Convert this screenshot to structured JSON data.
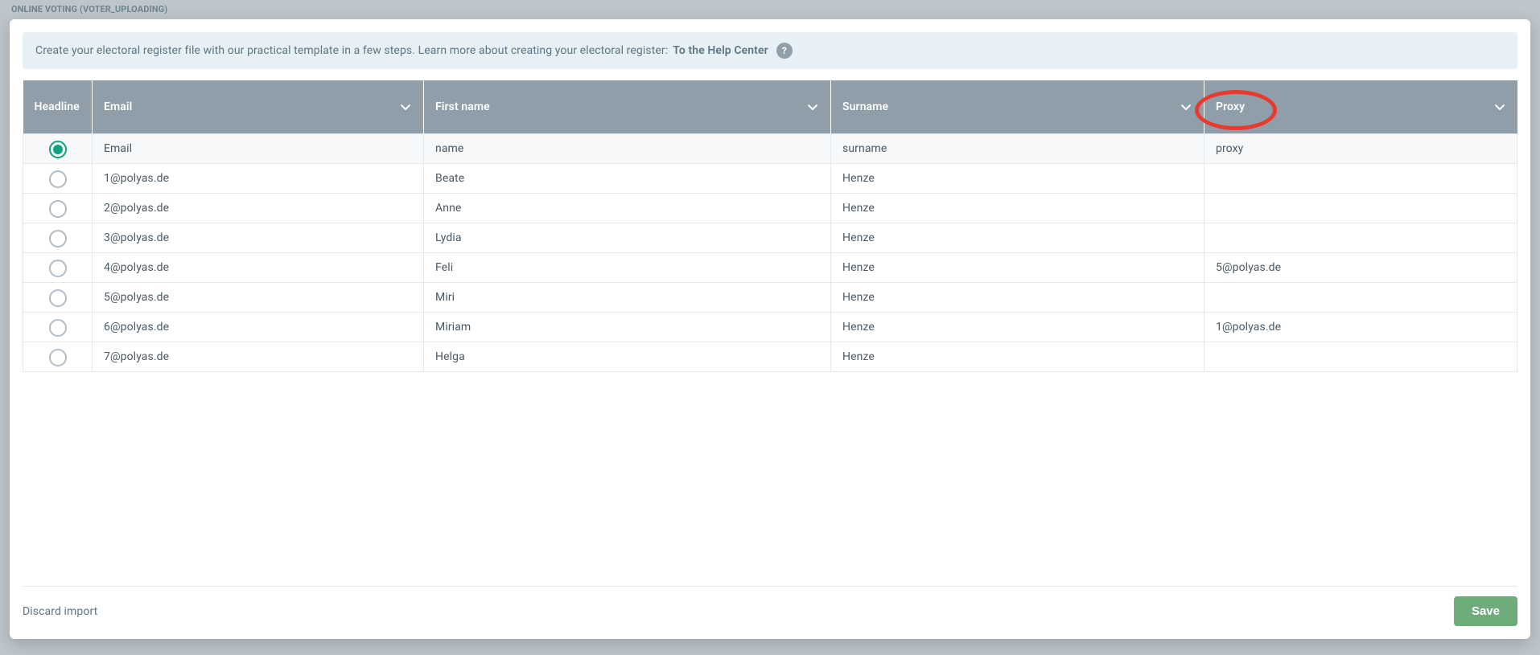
{
  "page_title": "ONLINE VOTING (VOTER_UPLOADING)",
  "banner": {
    "text": "Create your electoral register file with our practical template in a few steps. Learn more about creating your electoral register: ",
    "link_label": "To the Help Center",
    "help_tooltip": "?"
  },
  "columns": {
    "headline": "Headline",
    "email": "Email",
    "first": "First name",
    "surname": "Surname",
    "proxy": "Proxy"
  },
  "headline_selected_index": 0,
  "rows": [
    {
      "email": "Email",
      "first": "name",
      "surname": "surname",
      "proxy": "proxy"
    },
    {
      "email": "1@polyas.de",
      "first": "Beate",
      "surname": "Henze",
      "proxy": ""
    },
    {
      "email": "2@polyas.de",
      "first": "Anne",
      "surname": "Henze",
      "proxy": ""
    },
    {
      "email": "3@polyas.de",
      "first": "Lydia",
      "surname": "Henze",
      "proxy": ""
    },
    {
      "email": "4@polyas.de",
      "first": "Feli",
      "surname": "Henze",
      "proxy": "5@polyas.de"
    },
    {
      "email": "5@polyas.de",
      "first": "Miri",
      "surname": "Henze",
      "proxy": ""
    },
    {
      "email": "6@polyas.de",
      "first": "Miriam",
      "surname": "Henze",
      "proxy": "1@polyas.de"
    },
    {
      "email": "7@polyas.de",
      "first": "Helga",
      "surname": "Henze",
      "proxy": ""
    }
  ],
  "footer": {
    "discard": "Discard import",
    "save": "Save"
  },
  "annotation": {
    "highlight_column": "proxy"
  }
}
